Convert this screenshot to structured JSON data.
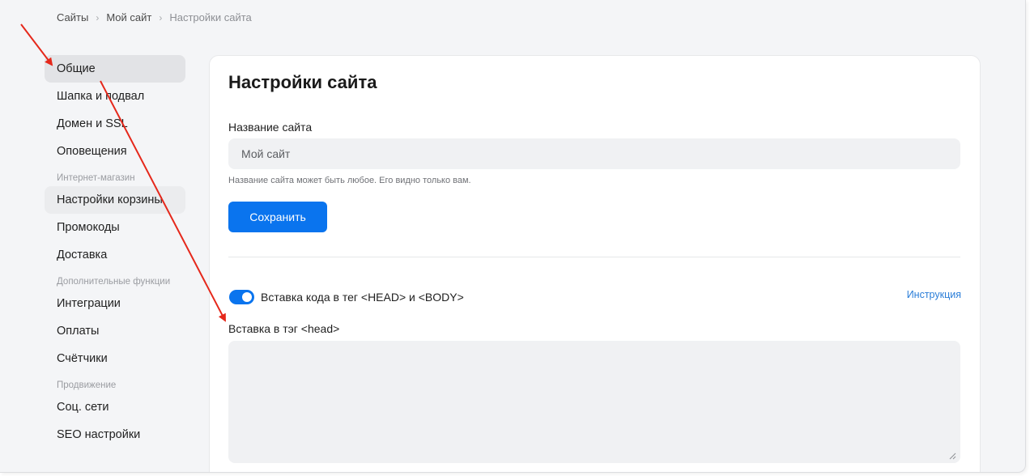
{
  "breadcrumb": {
    "items": [
      "Сайты",
      "Мой сайт",
      "Настройки сайта"
    ]
  },
  "sidebar": {
    "items": [
      {
        "label": "Общие"
      },
      {
        "label": "Шапка и подвал"
      },
      {
        "label": "Домен и SSL"
      },
      {
        "label": "Оповещения"
      }
    ],
    "sections": [
      {
        "title": "Интернет-магазин",
        "items": [
          {
            "label": "Настройки корзины"
          },
          {
            "label": "Промокоды"
          },
          {
            "label": "Доставка"
          }
        ]
      },
      {
        "title": "Дополнительные функции",
        "items": [
          {
            "label": "Интеграции"
          },
          {
            "label": "Оплаты"
          },
          {
            "label": "Счётчики"
          }
        ]
      },
      {
        "title": "Продвижение",
        "items": [
          {
            "label": "Соц. сети"
          },
          {
            "label": "SEO настройки"
          }
        ]
      }
    ]
  },
  "main": {
    "title": "Настройки сайта",
    "site_name_label": "Название сайта",
    "site_name_value": "Мой сайт",
    "site_name_hint": "Название сайта может быть любое. Его видно только вам.",
    "save_label": "Сохранить",
    "code_toggle_label": "Вставка кода в тег <HEAD> и <BODY>",
    "code_toggle_on": true,
    "instruction_link": "Инструкция",
    "head_label": "Вставка в тэг <head>",
    "head_value": ""
  },
  "colors": {
    "accent": "#0a74ee",
    "link": "#2b7ed8",
    "annotation": "#e5281b",
    "active_item_bg": "#e2e3e6",
    "page_bg": "#f4f5f7"
  },
  "icons": {
    "breadcrumb_separator": "chevron-right-icon",
    "annotation": "red-arrow-icon"
  }
}
